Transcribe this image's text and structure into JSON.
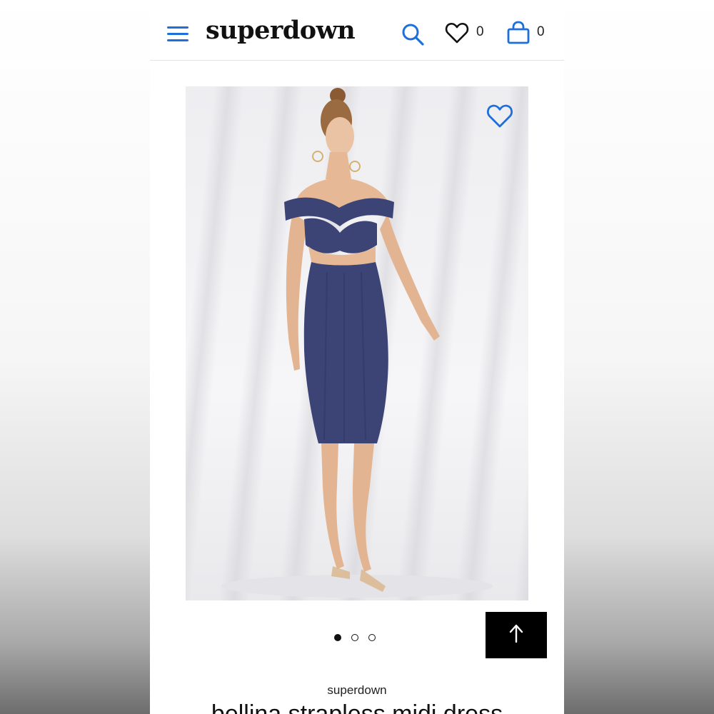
{
  "header": {
    "logo": "superdown",
    "wishlist_count": "0",
    "bag_count": "0"
  },
  "icons": {
    "menu": "hamburger-menu-icon",
    "search": "search-icon",
    "wishlist": "heart-icon",
    "bag": "shopping-bag-icon",
    "favorite": "heart-outline-icon",
    "back_to_top": "arrow-up-icon"
  },
  "colors": {
    "accent": "#1e6fd9",
    "dress": "#3c4476"
  },
  "carousel": {
    "slide_count": 3,
    "active_index": 0
  },
  "product": {
    "brand": "superdown",
    "title": "bellina strapless midi dress"
  }
}
